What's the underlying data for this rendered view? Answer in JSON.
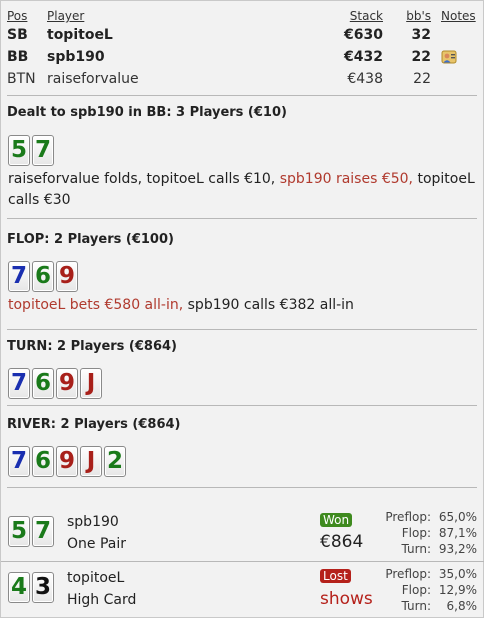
{
  "headers": {
    "pos": "Pos",
    "player": "Player",
    "stack": "Stack",
    "bbs": "bb's",
    "notes": "Notes"
  },
  "players": [
    {
      "pos": "SB",
      "name": "topitoeL",
      "stack": "€630",
      "bbs": "32",
      "bold": true
    },
    {
      "pos": "BB",
      "name": "spb190",
      "stack": "€432",
      "bbs": "22",
      "bold": true,
      "note_icon": "user-note-icon"
    },
    {
      "pos": "BTN",
      "name": "raiseforvalue",
      "stack": "€438",
      "bbs": "22",
      "bold": false
    }
  ],
  "preflop": {
    "title": "Dealt to spb190 in BB: 3 Players (€10)",
    "cards": [
      {
        "rank": "5",
        "color": "#1a7a1a"
      },
      {
        "rank": "7",
        "color": "#1a7a1a"
      }
    ],
    "action_1": "raiseforvalue folds, topitoeL calls €10, ",
    "action_raise": "spb190 raises €50,",
    "action_2": " topitoeL calls €30"
  },
  "flop": {
    "title": "FLOP: 2 Players (€100)",
    "cards": [
      {
        "rank": "7",
        "color": "#1a2fb0"
      },
      {
        "rank": "6",
        "color": "#1a7a1a"
      },
      {
        "rank": "9",
        "color": "#a8201a"
      }
    ],
    "action_bet": "topitoeL bets €580 all-in,",
    "action_call": " spb190 calls €382 all-in"
  },
  "turn": {
    "title": "TURN: 2 Players (€864)",
    "cards": [
      {
        "rank": "7",
        "color": "#1a2fb0"
      },
      {
        "rank": "6",
        "color": "#1a7a1a"
      },
      {
        "rank": "9",
        "color": "#a8201a"
      },
      {
        "rank": "J",
        "color": "#a8201a"
      }
    ]
  },
  "river": {
    "title": "RIVER: 2 Players (€864)",
    "cards": [
      {
        "rank": "7",
        "color": "#1a2fb0"
      },
      {
        "rank": "6",
        "color": "#1a7a1a"
      },
      {
        "rank": "9",
        "color": "#a8201a"
      },
      {
        "rank": "J",
        "color": "#a8201a"
      },
      {
        "rank": "2",
        "color": "#1a7a1a"
      }
    ]
  },
  "results": [
    {
      "cards": [
        {
          "rank": "5",
          "color": "#1a7a1a"
        },
        {
          "rank": "7",
          "color": "#1a7a1a"
        }
      ],
      "name": "spb190",
      "hand": "One Pair",
      "badge": "Won",
      "result_text": "€864",
      "equity_labels": [
        "Preflop:",
        "Flop:",
        "Turn:"
      ],
      "equity_values": [
        "65,0%",
        "87,1%",
        "93,2%"
      ]
    },
    {
      "cards": [
        {
          "rank": "4",
          "color": "#1a7a1a"
        },
        {
          "rank": "3",
          "color": "#111111"
        }
      ],
      "name": "topitoeL",
      "hand": "High Card",
      "badge": "Lost",
      "result_text": "shows",
      "equity_labels": [
        "Preflop:",
        "Flop:",
        "Turn:"
      ],
      "equity_values": [
        "35,0%",
        "12,9%",
        "6,8%"
      ]
    }
  ],
  "colors": {
    "raise_text": "#b03a2e",
    "won_badge": "#3e8a1e",
    "lost_badge": "#b5211b",
    "lost_text": "#b5211b"
  }
}
